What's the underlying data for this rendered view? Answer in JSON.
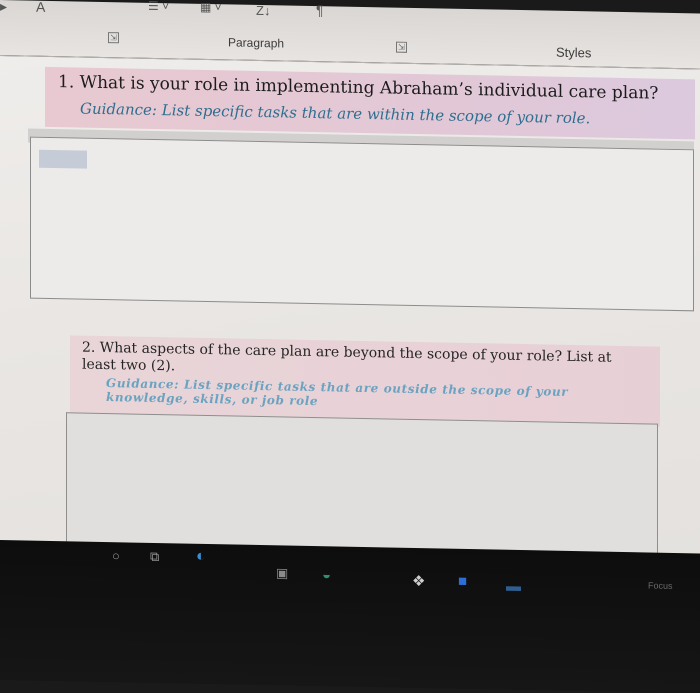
{
  "ribbon": {
    "font_letter": "A",
    "sort_glyph": "Z↓",
    "pilcrow": "¶",
    "paragraph_label": "Paragraph",
    "styles_label": "Styles",
    "launcher_glyph": "⇲"
  },
  "question1": {
    "title": "1.  What is your role in implementing Abraham’s individual care plan?",
    "guidance": "Guidance: List specific tasks that are within the scope of your role."
  },
  "question2": {
    "title": "2.  What aspects of the care plan are beyond the scope of your role? List at least two (2).",
    "guidance": "Guidance: List specific tasks that are outside the scope of your knowledge, skills, or job role"
  },
  "taskbar": {
    "focus_label": "Focus"
  },
  "colors": {
    "guidance_text": "#2f6e8f",
    "question_band": "#e8c9d1",
    "taskbar": "#111111"
  }
}
